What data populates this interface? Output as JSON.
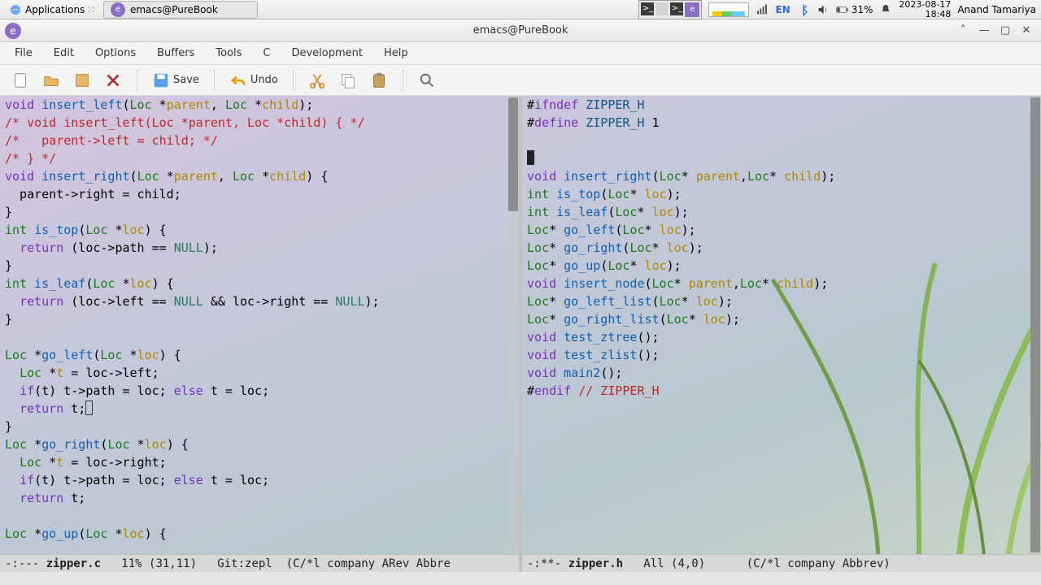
{
  "panel": {
    "applications": "Applications",
    "task_title": "emacs@PureBook",
    "lang": "EN",
    "battery": "31%",
    "date": "2023-08-17",
    "time": "18:48",
    "user": "Anand Tamariya"
  },
  "title": "emacs@PureBook",
  "menu": [
    "File",
    "Edit",
    "Options",
    "Buffers",
    "Tools",
    "C",
    "Development",
    "Help"
  ],
  "toolbar": {
    "save": "Save",
    "undo": "Undo"
  },
  "left": {
    "modeline_prefix": "-:--- ",
    "buffer": "zipper.c",
    "mode_pos": "   11% (31,11)   Git:zepl  (C/*l company ARev Abbre",
    "code": {
      "l01a": "void",
      "l01b": "insert_left",
      "l01c": "Loc",
      "l01d": "parent",
      "l01e": "Loc",
      "l01f": "child",
      "l02": "/* void insert_left(Loc *parent, Loc *child) { */",
      "l03": "/*   parent->left = child; */",
      "l04": "/* } */",
      "l05a": "void",
      "l05b": "insert_right",
      "l05c": "Loc",
      "l05d": "parent",
      "l05e": "Loc",
      "l05f": "child",
      "l06": "  parent->right = child;",
      "l07": "}",
      "l08a": "int",
      "l08b": "is_top",
      "l08c": "Loc",
      "l08d": "loc",
      "l09a": "return",
      "l09b": "NULL",
      "l10": "}",
      "l11a": "int",
      "l11b": "is_leaf",
      "l11c": "Loc",
      "l11d": "loc",
      "l12a": "return",
      "l12b": "NULL",
      "l12c": "NULL",
      "l13": "}",
      "l15a": "Loc",
      "l15b": "go_left",
      "l15c": "Loc",
      "l15d": "loc",
      "l16a": "Loc",
      "l17a": "if",
      "l17b": "else",
      "l18a": "return",
      "l19": "}",
      "l20a": "Loc",
      "l20b": "go_right",
      "l20c": "Loc",
      "l20d": "loc",
      "l21a": "Loc",
      "l22a": "if",
      "l22b": "else",
      "l23a": "return",
      "l25a": "Loc",
      "l25b": "go_up",
      "l25c": "Loc",
      "l25d": "loc"
    }
  },
  "right": {
    "modeline_prefix": "-:**- ",
    "buffer": "zipper.h",
    "mode_pos": "   All (4,0)      (C/*l company Abbrev)",
    "code": {
      "l01a": "ifndef",
      "l01b": "ZIPPER_H",
      "l02a": "define",
      "l02b": "ZIPPER_H",
      "l02c": "1",
      "l04a": "void",
      "l04b": "insert_right",
      "l04c": "Loc",
      "l04d": "Loc",
      "l05a": "int",
      "l05b": "is_top",
      "l05c": "Loc",
      "l06a": "int",
      "l06b": "is_leaf",
      "l06c": "Loc",
      "l07a": "Loc",
      "l07b": "go_left",
      "l07c": "Loc",
      "l08a": "Loc",
      "l08b": "go_right",
      "l08c": "Loc",
      "l09a": "Loc",
      "l09b": "go_up",
      "l09c": "Loc",
      "l10a": "void",
      "l10b": "insert_node",
      "l10c": "Loc",
      "l10d": "Loc",
      "l11a": "Loc",
      "l11b": "go_left_list",
      "l11c": "Loc",
      "l12a": "Loc",
      "l12b": "go_right_list",
      "l12c": "Loc",
      "l13a": "void",
      "l13b": "test_ztree",
      "l14a": "void",
      "l14b": "test_zlist",
      "l15a": "void",
      "l15b": "main2",
      "l16a": "endif",
      "l16b": "// ZIPPER_H"
    }
  }
}
